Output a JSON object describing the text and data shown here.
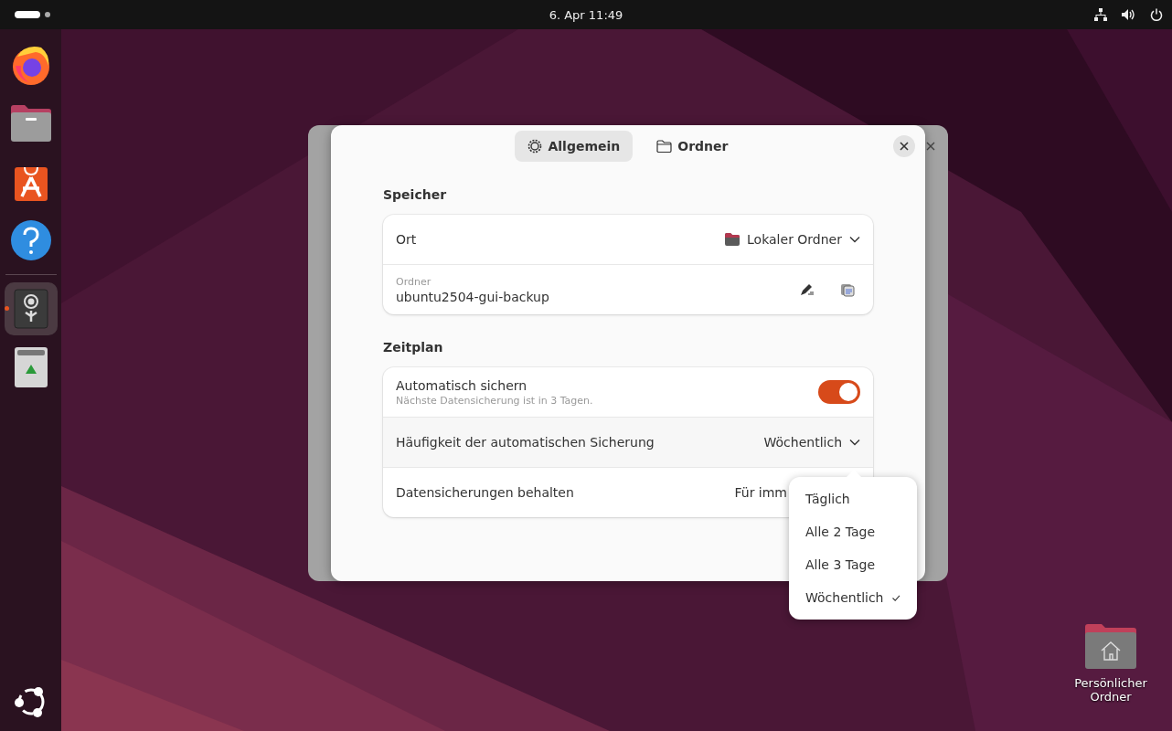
{
  "top_bar": {
    "clock": "6. Apr  11:49"
  },
  "dock": {
    "items": [
      {
        "kind": "firefox",
        "running": false
      },
      {
        "kind": "files",
        "running": false
      },
      {
        "kind": "store",
        "running": false
      },
      {
        "kind": "help",
        "running": false
      },
      {
        "kind": "backup",
        "running": true
      },
      {
        "kind": "trash",
        "running": false
      }
    ]
  },
  "dialog": {
    "tabs": [
      {
        "label": "Allgemein",
        "selected": true
      },
      {
        "label": "Ordner",
        "selected": false
      }
    ],
    "sections": [
      {
        "title": "Speicher",
        "rows": [
          {
            "kind": "dropdown",
            "label": "Ort",
            "value": "Lokaler Ordner",
            "value_icon": true
          },
          {
            "kind": "field",
            "caption": "Ordner",
            "value": "ubuntu2504-gui-backup"
          }
        ]
      },
      {
        "title": "Zeitplan",
        "rows": [
          {
            "kind": "switch",
            "label": "Automatisch sichern",
            "subtitle": "Nächste Datensicherung ist in 3 Tagen.",
            "on": true
          },
          {
            "kind": "dropdown",
            "label": "Häufigkeit der automatischen Sicherung",
            "value": "Wöchentlich",
            "open": true
          },
          {
            "kind": "dropdown",
            "label": "Datensicherungen behalten",
            "value": "Für imm",
            "covered": true
          }
        ]
      }
    ]
  },
  "popover": {
    "items": [
      {
        "label": "Täglich",
        "selected": false
      },
      {
        "label": "Alle 2 Tage",
        "selected": false
      },
      {
        "label": "Alle 3 Tage",
        "selected": false
      },
      {
        "label": "Wöchentlich",
        "selected": true
      }
    ]
  },
  "desktop_icons": [
    {
      "label": "Persönlicher Ordner"
    }
  ]
}
